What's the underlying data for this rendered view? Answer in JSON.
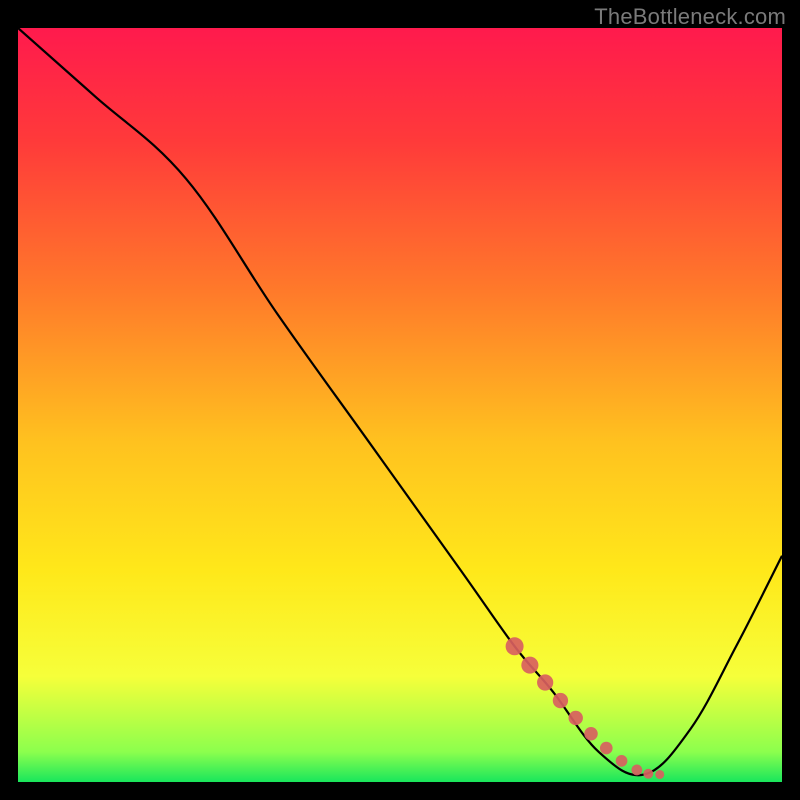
{
  "watermark": "TheBottleneck.com",
  "chart_data": {
    "type": "line",
    "title": "",
    "xlabel": "",
    "ylabel": "",
    "x_range": [
      0,
      100
    ],
    "y_range": [
      0,
      100
    ],
    "curve": {
      "name": "bottleneck-curve",
      "x": [
        0,
        10,
        22,
        34,
        46,
        58,
        65,
        70,
        76,
        82,
        88,
        94,
        100
      ],
      "y": [
        100,
        91,
        80,
        62,
        45,
        28,
        18,
        12,
        4,
        1,
        7,
        18,
        30
      ]
    },
    "highlight_segment": {
      "name": "optimal-zone-marker",
      "color": "#d86060",
      "x": [
        65,
        67,
        69,
        71,
        73,
        75,
        77,
        79,
        81,
        82.5,
        84
      ],
      "y": [
        18,
        15.5,
        13.2,
        10.8,
        8.5,
        6.4,
        4.5,
        2.8,
        1.6,
        1.1,
        1.0
      ]
    },
    "gradient_stops": [
      {
        "offset": 0,
        "color": "#ff1a4d"
      },
      {
        "offset": 15,
        "color": "#ff3a3a"
      },
      {
        "offset": 35,
        "color": "#ff7a2a"
      },
      {
        "offset": 55,
        "color": "#ffc21f"
      },
      {
        "offset": 72,
        "color": "#ffe81a"
      },
      {
        "offset": 86,
        "color": "#f6ff3a"
      },
      {
        "offset": 96,
        "color": "#8cff4d"
      },
      {
        "offset": 100,
        "color": "#19e65c"
      }
    ]
  }
}
